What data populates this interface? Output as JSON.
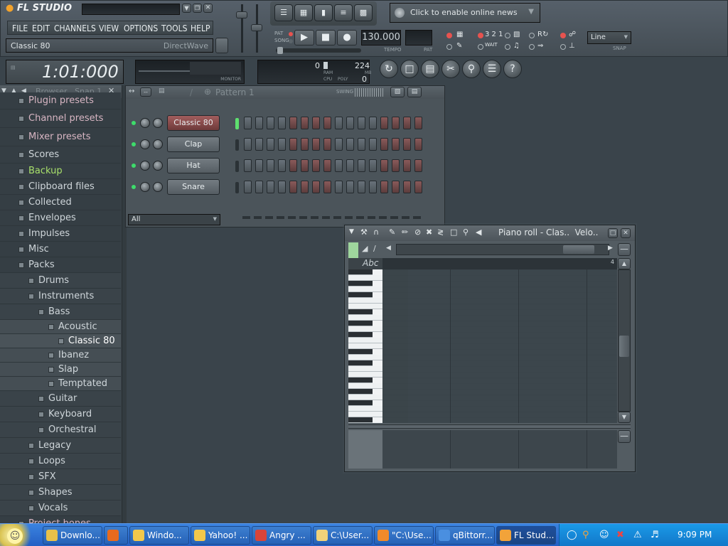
{
  "app": {
    "logo": "FL STUDIO",
    "menu": [
      "FILE",
      "EDIT",
      "CHANNELS",
      "VIEW",
      "OPTIONS",
      "TOOLS",
      "HELP"
    ],
    "hint_title": "Classic 80",
    "hint_right": "DirectWave",
    "time_display": "1:01:000",
    "tempo_value": "130.000",
    "tempo_label": "TEMPO",
    "pat_label": "PAT",
    "song_label": "SONG",
    "news_text": "Click to enable online news",
    "monitor_label": "MONITOR",
    "cpu_value": "0",
    "ram_value": "224",
    "poly_value": "0",
    "ram_label": "RAM",
    "cpu_label": "CPU",
    "poly_label": "POLY",
    "mb_label": "MB",
    "snap_value": "Line",
    "snap_label": "SNAP",
    "wait_label": "WAIT"
  },
  "browser": {
    "title": "Browser . Snap 1",
    "items": [
      {
        "label": "Plugin presets",
        "level": 0,
        "color": "#d8b6c3"
      },
      {
        "label": "Channel presets",
        "level": 0,
        "color": "#d8b6c3"
      },
      {
        "label": "Mixer presets",
        "level": 0,
        "color": "#d8b6c3"
      },
      {
        "label": "Scores",
        "level": 0,
        "color": "#cfd6da"
      },
      {
        "label": "Backup",
        "level": 0,
        "color": "#a8e06b"
      },
      {
        "label": "Clipboard files",
        "level": 0,
        "color": "#cfd6da"
      },
      {
        "label": "Collected",
        "level": 0,
        "color": "#cfd6da"
      },
      {
        "label": "Envelopes",
        "level": 0,
        "color": "#cfd6da"
      },
      {
        "label": "Impulses",
        "level": 0,
        "color": "#cfd6da"
      },
      {
        "label": "Misc",
        "level": 0,
        "color": "#cfd6da"
      },
      {
        "label": "Packs",
        "level": 0,
        "color": "#cfd6da"
      },
      {
        "label": "Drums",
        "level": 1,
        "color": "#cfd6da"
      },
      {
        "label": "Instruments",
        "level": 1,
        "color": "#cfd6da"
      },
      {
        "label": "Bass",
        "level": 2,
        "color": "#cfd6da"
      },
      {
        "label": "Acoustic",
        "level": 3,
        "color": "#cfd6da"
      },
      {
        "label": "Classic 80",
        "level": 4,
        "color": "#ffffff"
      },
      {
        "label": "Ibanez",
        "level": 3,
        "color": "#cfd6da"
      },
      {
        "label": "Slap",
        "level": 3,
        "color": "#cfd6da"
      },
      {
        "label": "Temptated",
        "level": 3,
        "color": "#cfd6da"
      },
      {
        "label": "Guitar",
        "level": 2,
        "color": "#cfd6da"
      },
      {
        "label": "Keyboard",
        "level": 2,
        "color": "#cfd6da"
      },
      {
        "label": "Orchestral",
        "level": 2,
        "color": "#cfd6da"
      },
      {
        "label": "Legacy",
        "level": 1,
        "color": "#cfd6da"
      },
      {
        "label": "Loops",
        "level": 1,
        "color": "#cfd6da"
      },
      {
        "label": "SFX",
        "level": 1,
        "color": "#cfd6da"
      },
      {
        "label": "Shapes",
        "level": 1,
        "color": "#cfd6da"
      },
      {
        "label": "Vocals",
        "level": 1,
        "color": "#cfd6da"
      },
      {
        "label": "Project bones",
        "level": 0,
        "color": "#d8b6c3"
      }
    ]
  },
  "step_sequencer": {
    "pattern_label": "Pattern 1",
    "swing_label": "SWING",
    "filter_value": "All",
    "channels": [
      {
        "name": "Classic 80",
        "selected": true
      },
      {
        "name": "Clap",
        "selected": false
      },
      {
        "name": "Hat",
        "selected": false
      },
      {
        "name": "Snare",
        "selected": false
      }
    ]
  },
  "piano_roll": {
    "title": "Piano roll - Clas..  Velo..",
    "abc_label": "Abc",
    "bar_number": "4"
  },
  "taskbar": {
    "clock": "9:09 PM",
    "items": [
      {
        "label": "Downlo...",
        "color": "#e8c14a"
      },
      {
        "label": "",
        "color": "#e86a1e"
      },
      {
        "label": "Windo...",
        "color": "#f2c84b"
      },
      {
        "label": "Yahoo! ...",
        "color": "#f2c84b"
      },
      {
        "label": "Angry ...",
        "color": "#d9443a"
      },
      {
        "label": "C:\\User...",
        "color": "#f0d27a"
      },
      {
        "label": "\"C:\\Use...",
        "color": "#f08a2a"
      },
      {
        "label": "qBittorr...",
        "color": "#4a8fe0"
      },
      {
        "label": "FL Stud...",
        "color": "#f2a33a"
      }
    ]
  }
}
